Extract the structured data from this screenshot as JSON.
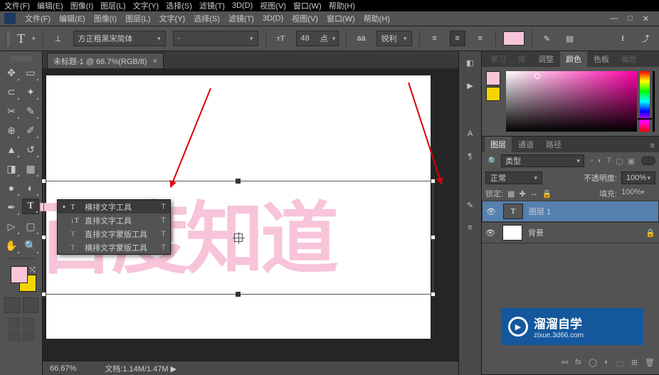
{
  "top_strip": [
    "文件(F)",
    "编辑(E)",
    "图像(I)",
    "图层(L)",
    "文字(Y)",
    "选择(S)",
    "滤镜(T)",
    "3D(D)",
    "视图(V)",
    "窗口(W)",
    "帮助(H)"
  ],
  "menu": {
    "items": [
      "文件(F)",
      "编辑(E)",
      "图像(I)",
      "图层(L)",
      "文字(Y)",
      "选择(S)",
      "滤镜(T)",
      "3D(D)",
      "视图(V)",
      "窗口(W)",
      "帮助(H)"
    ]
  },
  "options": {
    "font": "方正粗黑宋简体",
    "weight": "-",
    "size_value": "48",
    "size_unit": "点",
    "aa": "锐利",
    "color": "#f7c4d9"
  },
  "tab": {
    "title": "未标题-1 @ 66.7%(RGB/8)",
    "close": "×"
  },
  "canvas_text": "百度知道",
  "flyout": {
    "items": [
      {
        "icon": "T",
        "label": "横排文字工具",
        "sc": "T",
        "current": true
      },
      {
        "icon": "↓T",
        "label": "直排文字工具",
        "sc": "T"
      },
      {
        "icon": "T",
        "label": "直排文字蒙版工具",
        "sc": "T"
      },
      {
        "icon": "T",
        "label": "横排文字蒙版工具",
        "sc": "T"
      }
    ]
  },
  "status": {
    "zoom": "66.67%",
    "doc": "文档:",
    "size": "1.14M/1.47M"
  },
  "panels": {
    "color_tabs": [
      "学习",
      "库",
      "调整",
      "颜色",
      "色板",
      "属性"
    ],
    "color_active": 3,
    "swatches": {
      "fg": "#f7c4d9",
      "bg": "#f4d400"
    },
    "layer_tabs": [
      "图层",
      "通道",
      "路径"
    ],
    "layer_filter": "类型",
    "blend": "正常",
    "opacity_label": "不透明度:",
    "opacity": "100%",
    "lock_label": "锁定:",
    "fill_label": "填充:",
    "fill": "100%",
    "layers": [
      {
        "name": "图层 1",
        "type": "text",
        "selected": true
      },
      {
        "name": "背景",
        "type": "bg",
        "locked": true
      }
    ]
  },
  "watermark": {
    "t1": "溜溜自学",
    "t2": "zixue.3d66.com"
  }
}
